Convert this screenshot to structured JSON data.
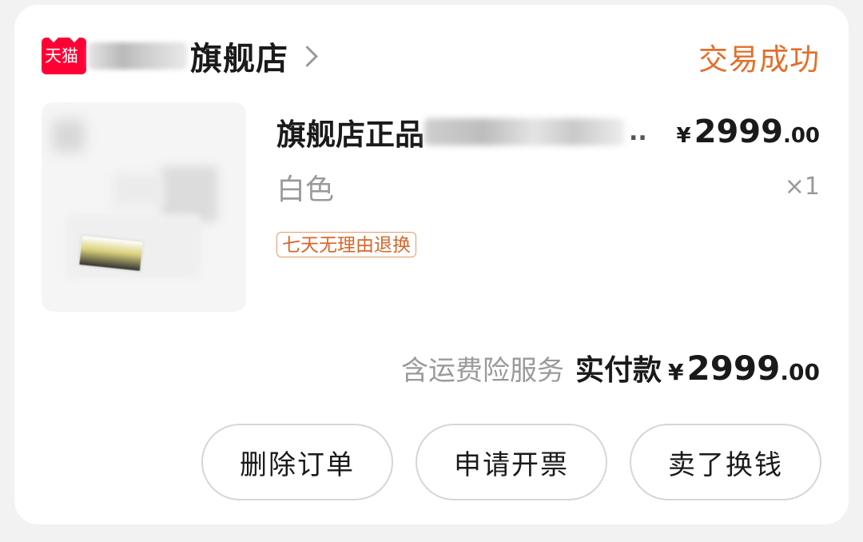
{
  "store": {
    "platform_badge": "天猫",
    "name_suffix": "旗舰店",
    "status": "交易成功"
  },
  "product": {
    "title_prefix": "旗舰店正品",
    "title_ellipsis": "..",
    "variant": "白色",
    "quantity": "×1",
    "price_symbol": "¥",
    "price_integer": "2999",
    "price_decimal": ".00",
    "tag": "七天无理由退换"
  },
  "summary": {
    "insurance_note": "含运费险服务",
    "paid_label": "实付款",
    "currency_symbol": "¥",
    "amount_integer": "2999",
    "amount_decimal": ".00"
  },
  "actions": {
    "delete_order": "删除订单",
    "request_invoice": "申请开票",
    "resell": "卖了换钱"
  },
  "colors": {
    "status": "#e36f2a",
    "tmall_brand": "#ff0036",
    "tag_text": "#d9662a",
    "muted_text": "#9a9a9a"
  }
}
